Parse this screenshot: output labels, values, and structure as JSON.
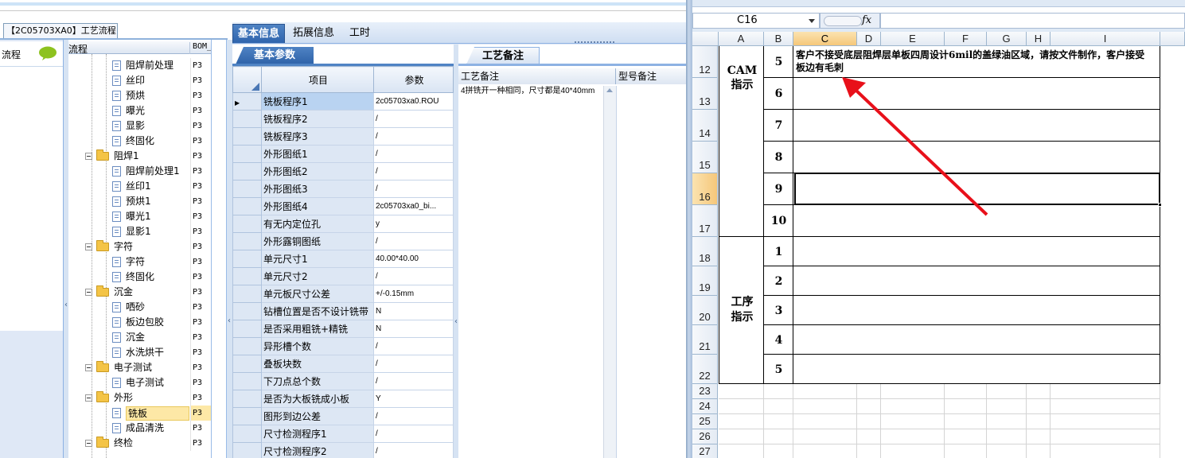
{
  "app": {
    "window_tab": "【2C05703XA0】工艺流程"
  },
  "left_panel": {
    "label": "流程",
    "chat_icon": "chat-bubble-icon"
  },
  "tree": {
    "header_name": "流程",
    "header_bom": "BOM_",
    "rows": [
      {
        "label": "阻焊前处理",
        "type": "doc",
        "level": 2,
        "code": "P3"
      },
      {
        "label": "丝印",
        "type": "doc",
        "level": 2,
        "code": "P3"
      },
      {
        "label": "预烘",
        "type": "doc",
        "level": 2,
        "code": "P3"
      },
      {
        "label": "曝光",
        "type": "doc",
        "level": 2,
        "code": "P3"
      },
      {
        "label": "显影",
        "type": "doc",
        "level": 2,
        "code": "P3"
      },
      {
        "label": "终固化",
        "type": "doc",
        "level": 2,
        "code": "P3"
      },
      {
        "label": "阻焊1",
        "type": "folder",
        "level": 1,
        "code": "P3"
      },
      {
        "label": "阻焊前处理1",
        "type": "doc",
        "level": 2,
        "code": "P3"
      },
      {
        "label": "丝印1",
        "type": "doc",
        "level": 2,
        "code": "P3"
      },
      {
        "label": "预烘1",
        "type": "doc",
        "level": 2,
        "code": "P3"
      },
      {
        "label": "曝光1",
        "type": "doc",
        "level": 2,
        "code": "P3"
      },
      {
        "label": "显影1",
        "type": "doc",
        "level": 2,
        "code": "P3"
      },
      {
        "label": "字符",
        "type": "folder",
        "level": 1,
        "code": "P3"
      },
      {
        "label": "字符",
        "type": "doc",
        "level": 2,
        "code": "P3"
      },
      {
        "label": "终固化",
        "type": "doc",
        "level": 2,
        "code": "P3"
      },
      {
        "label": "沉金",
        "type": "folder",
        "level": 1,
        "code": "P3"
      },
      {
        "label": "哂砂",
        "type": "doc",
        "level": 2,
        "code": "P3"
      },
      {
        "label": "板边包胶",
        "type": "doc",
        "level": 2,
        "code": "P3"
      },
      {
        "label": "沉金",
        "type": "doc",
        "level": 2,
        "code": "P3"
      },
      {
        "label": "水洗烘干",
        "type": "doc",
        "level": 2,
        "code": "P3"
      },
      {
        "label": "电子测试",
        "type": "folder",
        "level": 1,
        "code": "P3"
      },
      {
        "label": "电子测试",
        "type": "doc",
        "level": 2,
        "code": "P3"
      },
      {
        "label": "外形",
        "type": "folder",
        "level": 1,
        "code": "P3"
      },
      {
        "label": "铣板",
        "type": "doc",
        "level": 2,
        "code": "P3",
        "selected": true
      },
      {
        "label": "成品清洗",
        "type": "doc",
        "level": 2,
        "code": "P3"
      },
      {
        "label": "终检",
        "type": "folder",
        "level": 1,
        "code": "P3"
      }
    ]
  },
  "tabs": [
    {
      "label": "基本信息",
      "active": true
    },
    {
      "label": "拓展信息",
      "active": false
    },
    {
      "label": "工时",
      "active": false
    }
  ],
  "basic_params": {
    "tab_label": "基本参数",
    "col_item": "项目",
    "col_value": "参数",
    "rows": [
      {
        "item": "铣板程序1",
        "value": "2c05703xa0.ROU",
        "selected": true
      },
      {
        "item": "铣板程序2",
        "value": "/"
      },
      {
        "item": "铣板程序3",
        "value": "/"
      },
      {
        "item": "外形图纸1",
        "value": "/"
      },
      {
        "item": "外形图纸2",
        "value": "/"
      },
      {
        "item": "外形图纸3",
        "value": "/"
      },
      {
        "item": "外形图纸4",
        "value": "2c05703xa0_bi..."
      },
      {
        "item": "有无内定位孔",
        "value": "y"
      },
      {
        "item": "外形露铜图纸",
        "value": "/"
      },
      {
        "item": "单元尺寸1",
        "value": "40.00*40.00"
      },
      {
        "item": "单元尺寸2",
        "value": "/"
      },
      {
        "item": "单元板尺寸公差",
        "value": "+/-0.15mm"
      },
      {
        "item": "钻槽位置是否不设计铣带",
        "value": "N"
      },
      {
        "item": "是否采用粗铣+精铣",
        "value": "N"
      },
      {
        "item": "异形槽个数",
        "value": "/"
      },
      {
        "item": "叠板块数",
        "value": "/"
      },
      {
        "item": "下刀点总个数",
        "value": "/"
      },
      {
        "item": "是否为大板铣成小板",
        "value": "Y"
      },
      {
        "item": "图形到边公差",
        "value": "/"
      },
      {
        "item": "尺寸检测程序1",
        "value": "/"
      },
      {
        "item": "尺寸检测程序2",
        "value": "/"
      }
    ]
  },
  "process_notes": {
    "tab_label": "工艺备注",
    "col_note": "工艺备注",
    "col_model": "型号备注",
    "note_text": "4拼铣开一种相同，尺寸都是40*40mm"
  },
  "excel": {
    "name_box": "C16",
    "fx_label": "fx",
    "columns": [
      "A",
      "B",
      "C",
      "D",
      "E",
      "F",
      "G",
      "H",
      "I"
    ],
    "row_numbers": [
      "12",
      "13",
      "14",
      "15",
      "16",
      "17",
      "18",
      "19",
      "20",
      "21",
      "22",
      "23",
      "24",
      "25",
      "26",
      "27"
    ],
    "cam_label": "CAM\n指示",
    "process_label": "工序\n指示",
    "cam_numbers": [
      "5",
      "6",
      "7",
      "8",
      "9",
      "10"
    ],
    "process_numbers": [
      "1",
      "2",
      "3",
      "4",
      "5"
    ],
    "cam_note": "客户不接受底层阻焊层单板四周设计6mil的盖绿油区域，请按文件制作，客户接受板边有毛刺",
    "arrow_color": "#e8101a"
  }
}
